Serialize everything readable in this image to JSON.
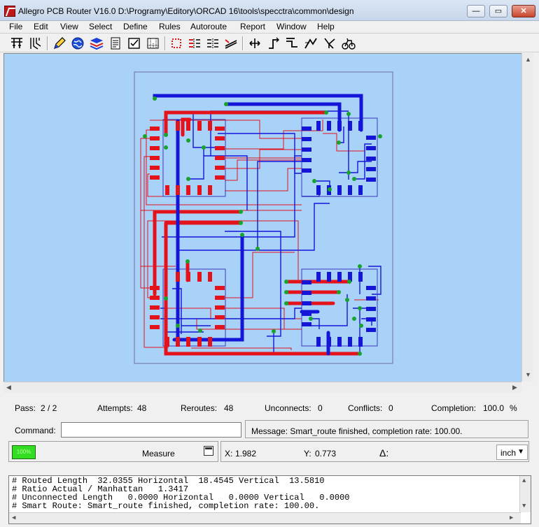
{
  "window": {
    "title": "Allegro PCB Router V16.0 D:\\Programy\\Editory\\ORCAD 16\\tools\\specctra\\common\\design",
    "minimize_glyph": "—",
    "maximize_glyph": "▭",
    "close_glyph": "✕"
  },
  "menu": [
    "File",
    "Edit",
    "View",
    "Select",
    "Define",
    "Rules",
    "Autoroute",
    "Report",
    "Window",
    "Help"
  ],
  "toolbar": {
    "icons": [
      "select-mode-icon",
      "route-mode-icon",
      "pen-icon",
      "globe-icon",
      "layers-icon",
      "document-icon",
      "checkbox-icon",
      "grid-icon",
      "component-icon",
      "fanout-icon",
      "bus-icon",
      "diagonal-route-icon",
      "move-icon",
      "wire-icon",
      "wire-alt-icon",
      "smart-route-icon",
      "fork-icon",
      "bike-icon"
    ]
  },
  "colors": {
    "canvas": "#a9d2f8",
    "board_fill": "#a9d2f8",
    "top_layer": "#e3121b",
    "bottom_layer": "#1515d8",
    "via": "#17a32c",
    "board_outline": "#6e6e9e"
  },
  "status": {
    "pass_label": "Pass:",
    "pass_value": "2 / 2",
    "attempts_label": "Attempts:",
    "attempts_value": "48",
    "reroutes_label": "Reroutes:",
    "reroutes_value": "48",
    "unconnects_label": "Unconnects:",
    "unconnects_value": "0",
    "conflicts_label": "Conflicts:",
    "conflicts_value": "0",
    "completion_label": "Completion:",
    "completion_value": "100.0",
    "completion_unit": "%"
  },
  "command": {
    "label": "Command:",
    "value": "",
    "message": "Message:  Smart_route finished, completion rate: 100.00."
  },
  "coords": {
    "led_text": "100%",
    "measure_label": "Measure",
    "x_label": "X:",
    "x_value": "1.982",
    "y_label": "Y:",
    "y_value": "0.773",
    "delta_label": "Δ:",
    "unit": "inch"
  },
  "console": {
    "lines": [
      "# Routed Length  32.0355 Horizontal  18.4545 Vertical  13.5810",
      "# Ratio Actual / Manhattan   1.3417",
      "# Unconnected Length   0.0000 Horizontal   0.0000 Vertical   0.0000",
      "# Smart Route: Smart_route finished, completion rate: 100.00."
    ]
  }
}
